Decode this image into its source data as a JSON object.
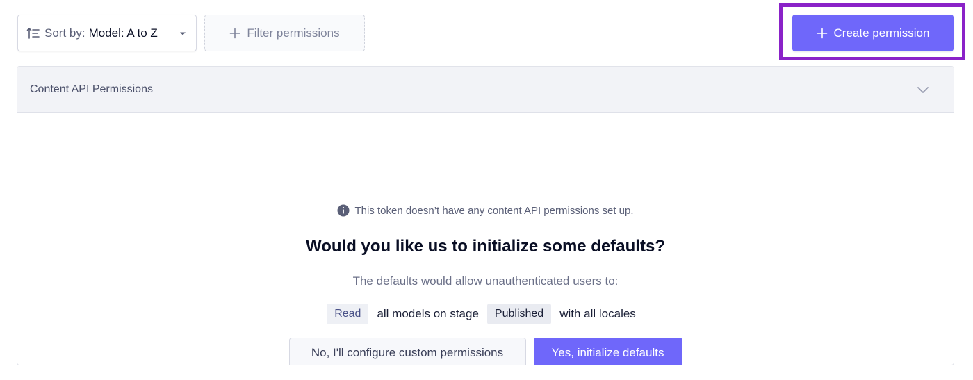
{
  "toolbar": {
    "sort_prefix": "Sort by:",
    "sort_value": "Model: A to Z",
    "filter_label": "Filter permissions",
    "create_label": "Create permission"
  },
  "panel": {
    "title": "Content API Permissions",
    "info_text": "This token doesn’t have any content API permissions set up.",
    "question": "Would you like us to initialize some defaults?",
    "description": "The defaults would allow unauthenticated users to:",
    "defaults_line": {
      "action": "Read",
      "text1": "all models on stage",
      "stage": "Published",
      "text2": "with all locales"
    },
    "decline_label": "No, I'll configure custom permissions",
    "accept_label": "Yes, initialize defaults"
  },
  "colors": {
    "primary": "#6f67fa",
    "highlight_border": "#8a22c8",
    "header_bg": "#f2f3f7"
  },
  "icons": {
    "sort": "sort-ascending-icon",
    "caret": "caret-down-icon",
    "filter": "plus-icon",
    "create": "plus-icon",
    "chevron": "chevron-down-icon",
    "info": "info-icon"
  }
}
